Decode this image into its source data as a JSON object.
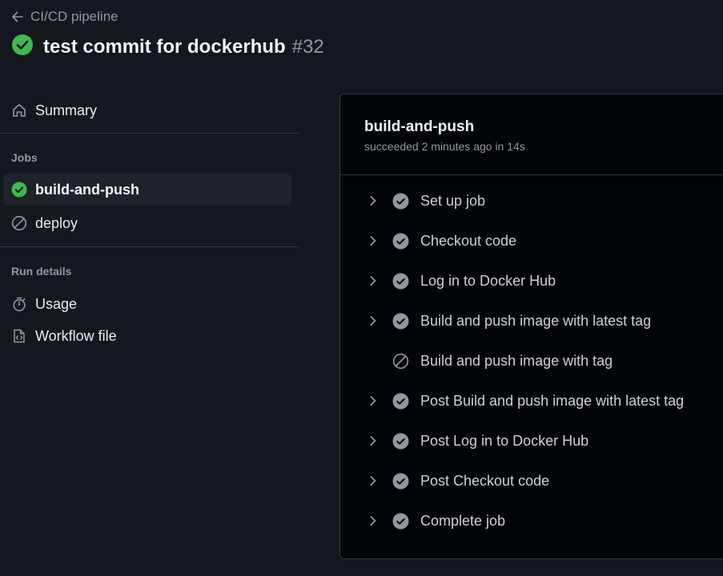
{
  "header": {
    "back_label": "CI/CD pipeline",
    "title": "test commit for dockerhub",
    "run_number": "#32"
  },
  "sidebar": {
    "summary_label": "Summary",
    "jobs_heading": "Jobs",
    "jobs": [
      {
        "label": "build-and-push",
        "status": "success",
        "active": true
      },
      {
        "label": "deploy",
        "status": "skipped",
        "active": false
      }
    ],
    "run_details_heading": "Run details",
    "details": [
      {
        "label": "Usage",
        "icon": "stopwatch-icon"
      },
      {
        "label": "Workflow file",
        "icon": "file-code-icon"
      }
    ]
  },
  "job": {
    "name": "build-and-push",
    "status_text": "succeeded 2 minutes ago in 14s",
    "steps": [
      {
        "label": "Set up job",
        "status": "success",
        "expandable": true
      },
      {
        "label": "Checkout code",
        "status": "success",
        "expandable": true
      },
      {
        "label": "Log in to Docker Hub",
        "status": "success",
        "expandable": true
      },
      {
        "label": "Build and push image with latest tag",
        "status": "success",
        "expandable": true
      },
      {
        "label": "Build and push image with tag",
        "status": "skipped",
        "expandable": false
      },
      {
        "label": "Post Build and push image with latest tag",
        "status": "success",
        "expandable": true
      },
      {
        "label": "Post Log in to Docker Hub",
        "status": "success",
        "expandable": true
      },
      {
        "label": "Post Checkout code",
        "status": "success",
        "expandable": true
      },
      {
        "label": "Complete job",
        "status": "success",
        "expandable": true
      }
    ]
  },
  "colors": {
    "success": "#3fb950",
    "muted": "#9198a1",
    "background": "#14171e",
    "panel": "#010409",
    "border": "#30363d"
  }
}
